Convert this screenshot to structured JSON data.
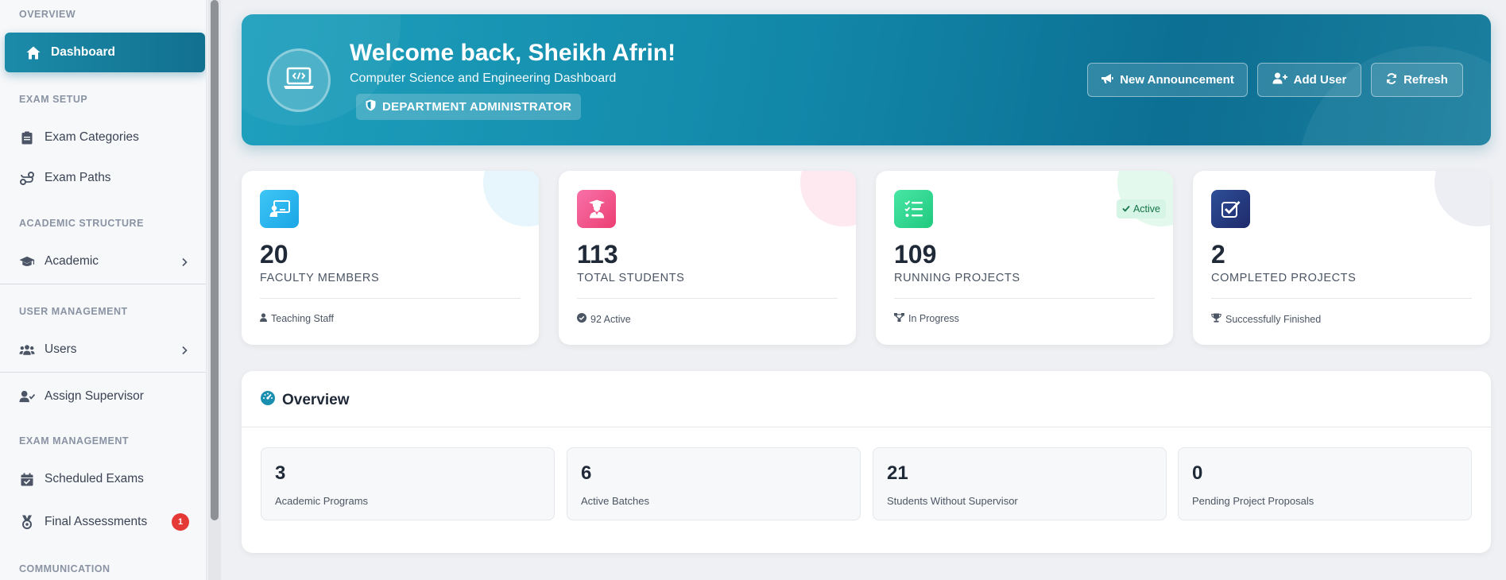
{
  "sidebar": {
    "sections": {
      "overview": "OVERVIEW",
      "exam_setup": "EXAM SETUP",
      "academic_structure": "ACADEMIC STRUCTURE",
      "user_management": "USER MANAGEMENT",
      "exam_management": "EXAM MANAGEMENT",
      "communication": "COMMUNICATION"
    },
    "items": {
      "dashboard": "Dashboard",
      "exam_categories": "Exam Categories",
      "exam_paths": "Exam Paths",
      "academic": "Academic",
      "users": "Users",
      "assign_supervisor": "Assign Supervisor",
      "scheduled_exams": "Scheduled Exams",
      "final_assessments": "Final Assessments",
      "final_assessments_badge": "1"
    }
  },
  "hero": {
    "title": "Welcome back, Sheikh Afrin!",
    "subtitle": "Computer Science and Engineering Dashboard",
    "role": "DEPARTMENT ADMINISTRATOR",
    "buttons": {
      "announcement": "New Announcement",
      "add_user": "Add User",
      "refresh": "Refresh"
    }
  },
  "stats": [
    {
      "value": "20",
      "label": "FACULTY MEMBERS",
      "footer": "Teaching Staff",
      "icon": "chalkboard-teacher-icon"
    },
    {
      "value": "113",
      "label": "TOTAL STUDENTS",
      "footer": "92 Active",
      "icon": "graduate-icon"
    },
    {
      "value": "109",
      "label": "RUNNING PROJECTS",
      "footer": "In Progress",
      "badge": "Active",
      "icon": "task-list-icon"
    },
    {
      "value": "2",
      "label": "COMPLETED PROJECTS",
      "footer": "Successfully Finished",
      "icon": "double-check-icon"
    }
  ],
  "overview": {
    "title": "Overview",
    "items": [
      {
        "value": "3",
        "label": "Academic Programs"
      },
      {
        "value": "6",
        "label": "Active Batches"
      },
      {
        "value": "21",
        "label": "Students Without Supervisor"
      },
      {
        "value": "0",
        "label": "Pending Project Proposals"
      }
    ]
  },
  "colors": {
    "accent": "#1287a8",
    "faculty_icon": "#21b8f0",
    "students_icon": "#f2508a",
    "projects_icon": "#2fd88e",
    "completed_icon": "#263a80",
    "badge_red": "#e53935"
  }
}
